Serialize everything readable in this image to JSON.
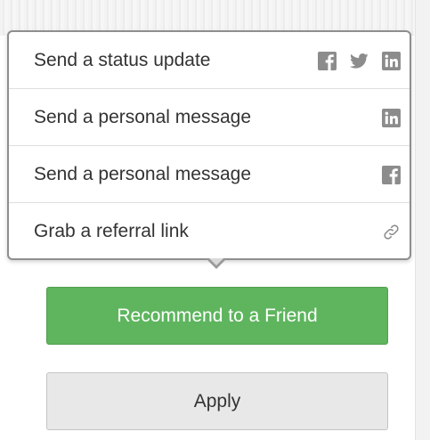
{
  "share_menu": {
    "items": [
      {
        "label": "Send a status update",
        "icons": [
          "facebook-icon",
          "twitter-icon",
          "linkedin-icon"
        ]
      },
      {
        "label": "Send a personal message",
        "icons": [
          "linkedin-icon"
        ]
      },
      {
        "label": "Send a personal message",
        "icons": [
          "facebook-icon"
        ]
      },
      {
        "label": "Grab a referral link",
        "icons": [
          "link-icon"
        ]
      }
    ]
  },
  "buttons": {
    "recommend_label": "Recommend to a Friend",
    "apply_label": "Apply"
  },
  "colors": {
    "recommend_bg": "#5eb55e",
    "apply_bg": "#e8e8e8",
    "icon_gray": "#8c8c8c",
    "text": "#333333"
  }
}
